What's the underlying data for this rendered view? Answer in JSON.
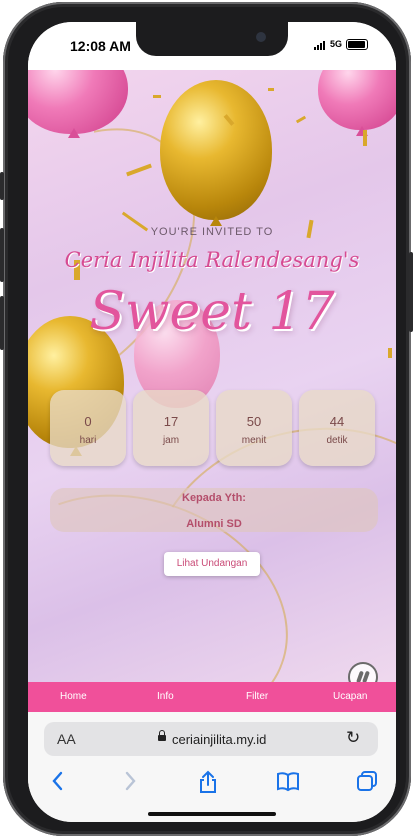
{
  "status_bar": {
    "time": "12:08 AM",
    "network": "5G"
  },
  "invite": {
    "invited_text": "YOU'RE INVITED TO",
    "name": "Ceria Injilita Ralendesang's",
    "event": "Sweet 17"
  },
  "countdown": [
    {
      "value": "0",
      "label": "hari"
    },
    {
      "value": "17",
      "label": "jam"
    },
    {
      "value": "50",
      "label": "menit"
    },
    {
      "value": "44",
      "label": "detik"
    }
  ],
  "recipient": {
    "heading": "Kepada Yth:",
    "guest": "Alumni SD"
  },
  "cta_label": "Lihat Undangan",
  "nav": [
    "Home",
    "Info",
    "Filter",
    "Ucapan"
  ],
  "browser": {
    "aa": "AA",
    "url": "ceriainjilita.my.id"
  },
  "icons": {
    "music": "pause-music-icon",
    "back": "chevron-left-icon",
    "forward": "chevron-right-icon",
    "share": "share-icon",
    "bookmarks": "book-icon",
    "tabs": "tabs-icon",
    "reload": "reload-icon",
    "lock": "lock-icon"
  },
  "colors": {
    "accent_pink": "#f0509a",
    "safari_blue": "#1a73e8",
    "title_pink": "#e2559d"
  }
}
